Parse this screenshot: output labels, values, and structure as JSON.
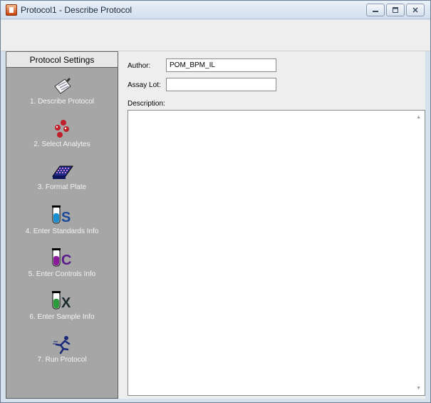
{
  "window": {
    "title": "Protocol1 - Describe Protocol"
  },
  "nav": {
    "header": "Protocol Settings",
    "items": [
      {
        "label": "1. Describe Protocol",
        "icon": "describe-icon"
      },
      {
        "label": "2. Select Analytes",
        "icon": "analytes-icon"
      },
      {
        "label": "3. Format Plate",
        "icon": "plate-icon"
      },
      {
        "label": "4. Enter Standards Info",
        "icon": "standards-tube-icon"
      },
      {
        "label": "5. Enter Controls Info",
        "icon": "controls-tube-icon"
      },
      {
        "label": "6. Enter Sample Info",
        "icon": "sample-tube-icon"
      },
      {
        "label": "7. Run Protocol",
        "icon": "run-icon"
      }
    ]
  },
  "form": {
    "author_label": "Author:",
    "author_value": "POM_BPM_IL",
    "assay_lot_label": "Assay Lot:",
    "assay_lot_value": "",
    "description_label": "Description:",
    "description_value": ""
  }
}
